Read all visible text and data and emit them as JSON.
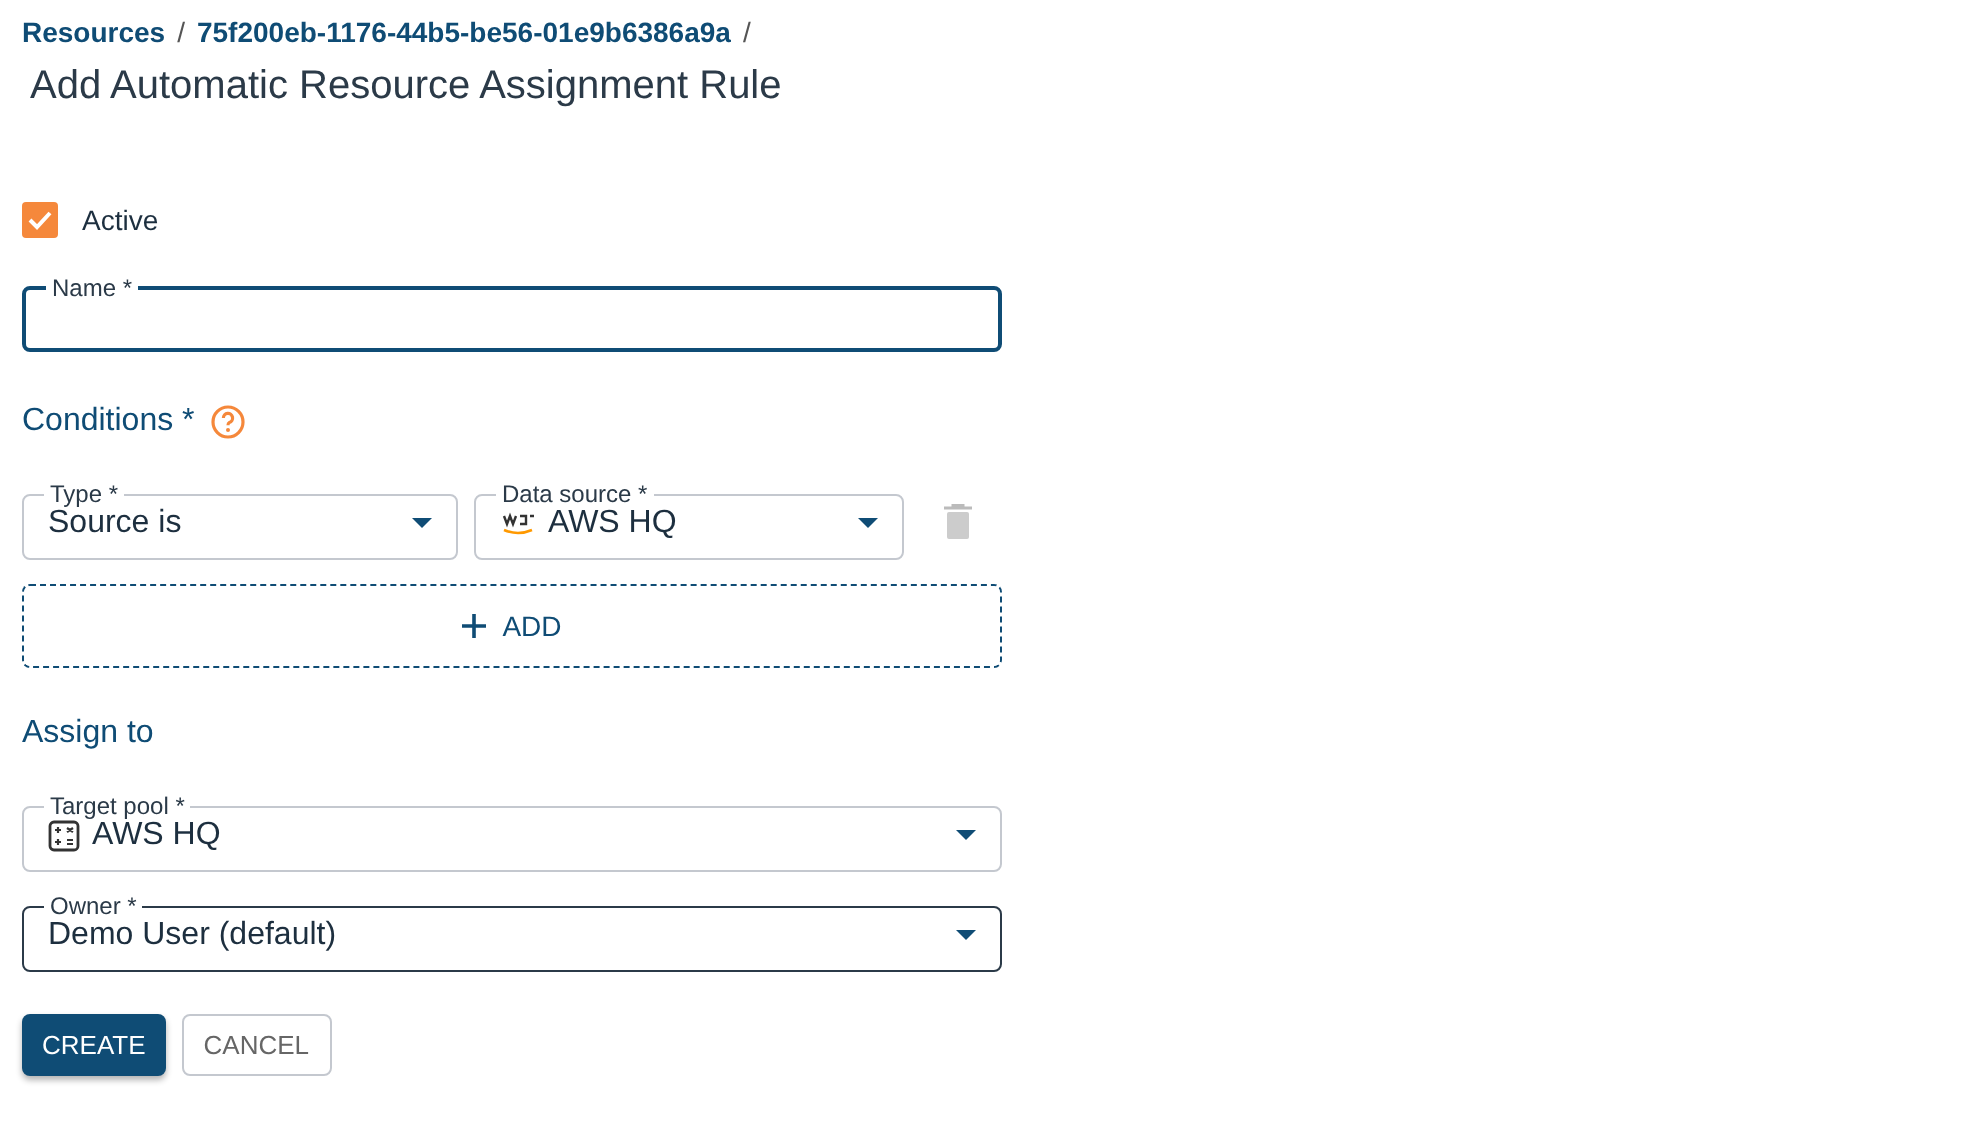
{
  "breadcrumbs": [
    {
      "label": "Resources"
    },
    {
      "label": "75f200eb-1176-44b5-be56-01e9b6386a9a"
    }
  ],
  "breadcrumb_separator": "/",
  "title": "Add Automatic Resource Assignment Rule",
  "active": {
    "label": "Active",
    "checked": true
  },
  "name_field": {
    "label": "Name *",
    "focused": true
  },
  "conditions": {
    "title": "Conditions *",
    "rows": [
      {
        "type": {
          "label": "Type *",
          "value": "Source is"
        },
        "data_source": {
          "label": "Data source *",
          "value": "AWS HQ"
        }
      }
    ],
    "add_label": "ADD"
  },
  "assign_to": {
    "title": "Assign to",
    "fields": [
      {
        "label": "Target pool *",
        "value": "AWS HQ",
        "hovered": false
      },
      {
        "label": "Owner *",
        "value": "Demo User (default)",
        "hovered": true
      }
    ]
  },
  "buttons": [
    {
      "label": "CREATE",
      "kind": "primary"
    },
    {
      "label": "CANCEL",
      "kind": "secondary"
    }
  ]
}
